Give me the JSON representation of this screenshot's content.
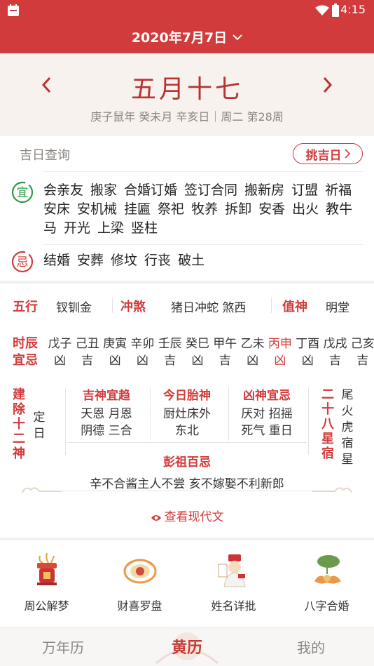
{
  "status_bar": {
    "time": "4:15"
  },
  "top_bar": {
    "date": "2020年7月7日"
  },
  "header": {
    "lunar_date": "五月十七",
    "ganzhi_line": "庚子鼠年 癸未月 辛亥日｜周二 第28周"
  },
  "jiri": {
    "title": "吉日查询",
    "button_label": "挑吉日",
    "yi_badge": "宜",
    "ji_badge": "忌",
    "yi_items": [
      "会亲友",
      "搬家",
      "合婚订婚",
      "签订合同",
      "搬新房",
      "订盟",
      "祈福",
      "安床",
      "安机械",
      "挂匾",
      "祭祀",
      "牧养",
      "拆卸",
      "安香",
      "出火",
      "教牛",
      "马",
      "开光",
      "上梁",
      "竖柱"
    ],
    "ji_items": [
      "结婚",
      "安葬",
      "修坟",
      "行丧",
      "破土"
    ]
  },
  "almanac": {
    "wuxing_label": "五行",
    "wuxing_value": "钗钏金",
    "chongsha_label": "冲煞",
    "chongsha_value": "猪日冲蛇 煞西",
    "zhishen_label": "值神",
    "zhishen_value": "明堂",
    "shichen_label": "时辰",
    "yiji_label": "宜忌",
    "hours": [
      {
        "name": "戊子",
        "luck": "凶"
      },
      {
        "name": "己丑",
        "luck": "吉"
      },
      {
        "name": "庚寅",
        "luck": "凶"
      },
      {
        "name": "辛卯",
        "luck": "凶"
      },
      {
        "name": "壬辰",
        "luck": "吉"
      },
      {
        "name": "癸巳",
        "luck": "凶"
      },
      {
        "name": "甲午",
        "luck": "吉"
      },
      {
        "name": "乙未",
        "luck": "凶"
      },
      {
        "name": "丙申",
        "luck": "凶"
      },
      {
        "name": "丁酉",
        "luck": "凶"
      },
      {
        "name": "戊戌",
        "luck": "吉"
      },
      {
        "name": "己亥",
        "luck": "吉"
      }
    ],
    "current_hour_index": 8,
    "jianchu_title": "建除十二神",
    "jianchu_value": "定日",
    "jishen_title": "吉神宜趋",
    "jishen_line1": "天恩 月恩",
    "jishen_line2": "阴德 三合",
    "taishen_title": "今日胎神",
    "taishen_line1": "厨灶床外",
    "taishen_line2": "东北",
    "xiongshen_title": "凶神宜忌",
    "xiongshen_line1": "厌对 招摇",
    "xiongshen_line2": "死气 重日",
    "xiu_title": "二十八星宿",
    "xiu_value": "尾火虎宿星",
    "pengzu_title": "彭祖百忌",
    "pengzu_text": "辛不合酱主人不尝 亥不嫁娶不利新郎",
    "modern_link": "查看现代文"
  },
  "tools": [
    {
      "label": "周公解梦",
      "icon": "incense-burner-icon"
    },
    {
      "label": "财喜罗盘",
      "icon": "compass-icon"
    },
    {
      "label": "姓名详批",
      "icon": "scholar-icon"
    },
    {
      "label": "八字合婚",
      "icon": "lotus-icon"
    }
  ],
  "tabs": [
    {
      "label": "万年历"
    },
    {
      "label": "黄历"
    },
    {
      "label": "我的"
    }
  ],
  "colors": {
    "accent": "#d23b3b",
    "header_bg": "#f7f2ee",
    "page_bg": "#f3f1ee"
  }
}
